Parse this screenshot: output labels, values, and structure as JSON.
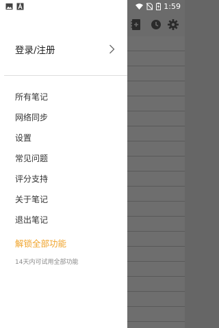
{
  "status_bar": {
    "time": "1:59",
    "left_icons": [
      "image-icon",
      "text-a-icon"
    ],
    "right_icons": [
      "wifi-icon",
      "no-sim-icon",
      "battery-icon"
    ]
  },
  "app": {
    "toolbar_icons": [
      "notebook-icon",
      "clock-icon",
      "gear-icon"
    ],
    "colors": {
      "overlay": "#6b6b6b",
      "accent": "#f0a42c"
    }
  },
  "drawer": {
    "login_label": "登录/注册",
    "menu_items": [
      "所有笔记",
      "网络同步",
      "设置",
      "常见问题",
      "评分支持",
      "关于笔记",
      "退出笔记"
    ],
    "unlock_label": "解锁全部功能",
    "trial_text": "14天内可试用全部功能"
  }
}
